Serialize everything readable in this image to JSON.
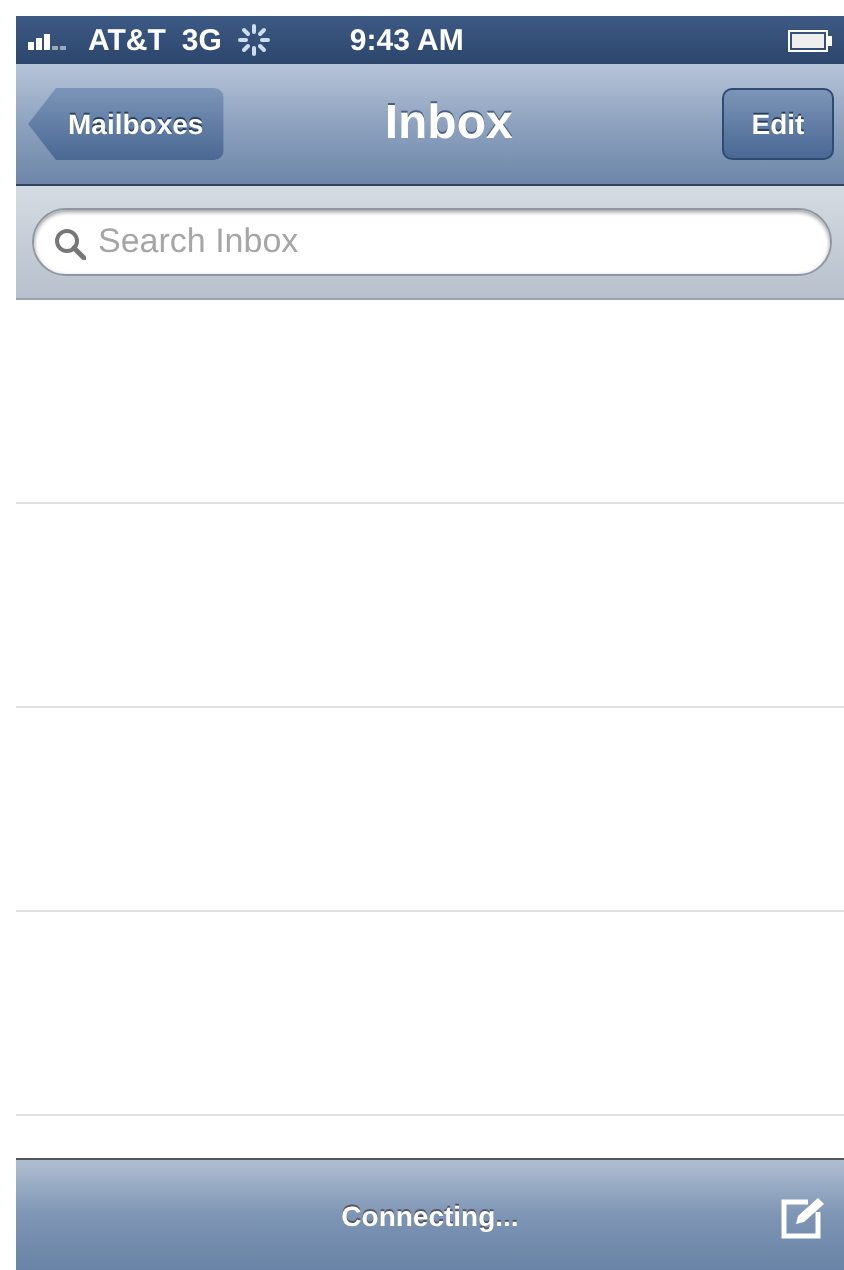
{
  "status_bar": {
    "carrier": "AT&T",
    "network": "3G",
    "time": "9:43 AM"
  },
  "nav_bar": {
    "back_button": "Mailboxes",
    "title": "Inbox",
    "edit_button": "Edit"
  },
  "search": {
    "placeholder": "Search Inbox"
  },
  "toolbar": {
    "status": "Connecting..."
  }
}
